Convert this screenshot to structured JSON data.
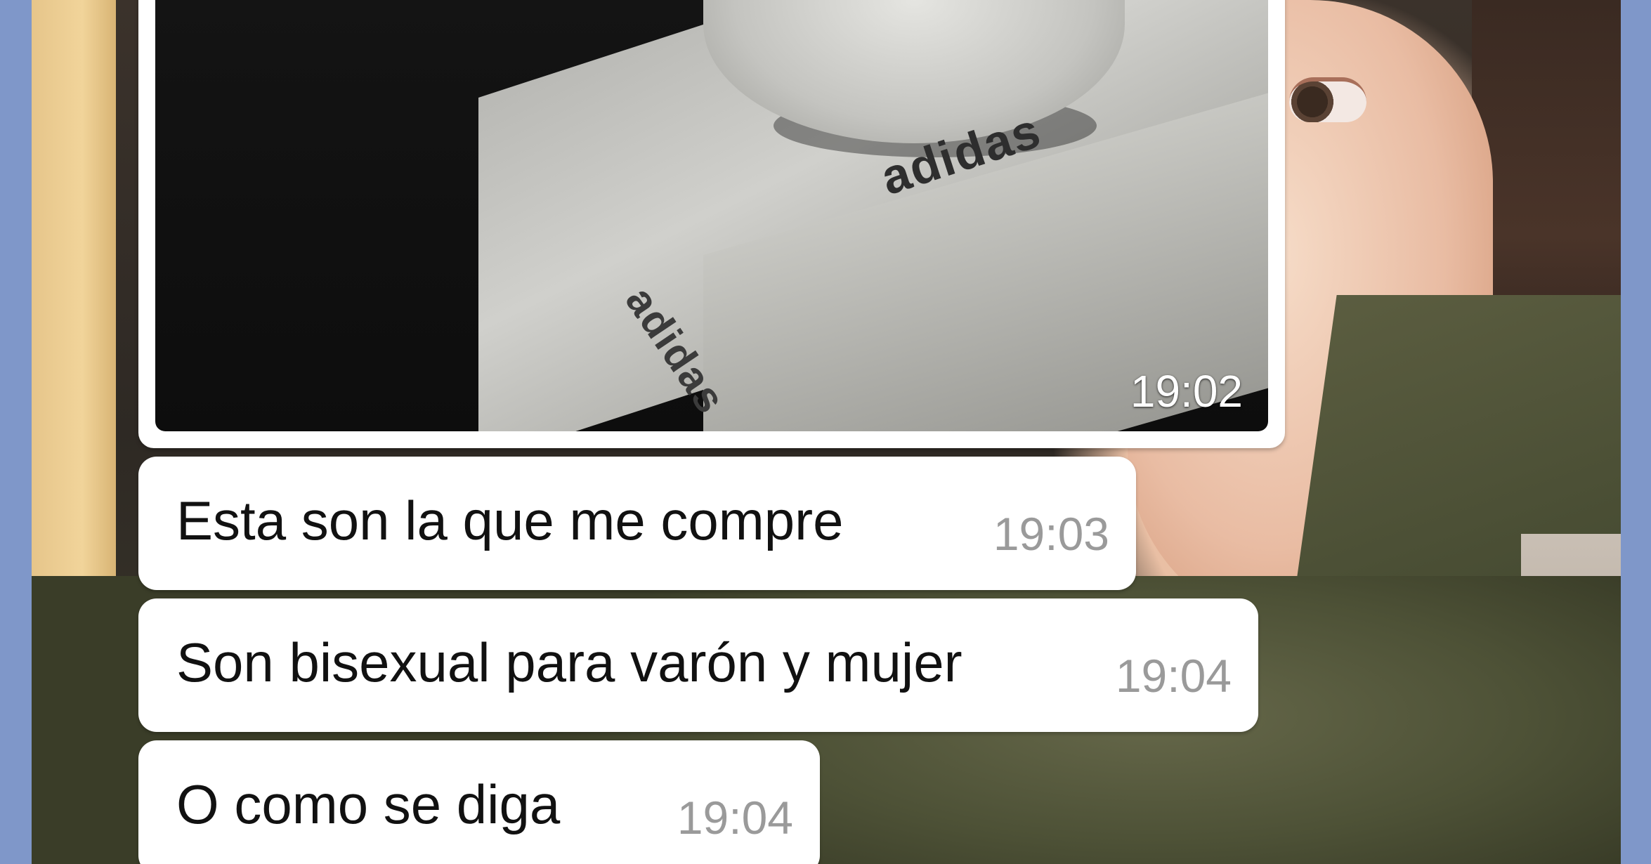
{
  "chat": {
    "media_message": {
      "time": "19:02",
      "brand_text": "adidas"
    },
    "messages": [
      {
        "text": "Esta son la que me compre",
        "time": "19:03"
      },
      {
        "text": "Son bisexual para varón y mujer",
        "time": "19:04"
      },
      {
        "text": "O como se diga",
        "time": "19:04"
      }
    ]
  },
  "colors": {
    "frame_border": "#7f97c9",
    "bubble": "#ffffff",
    "message_text": "#111111",
    "timestamp": "#9a9a9a"
  }
}
